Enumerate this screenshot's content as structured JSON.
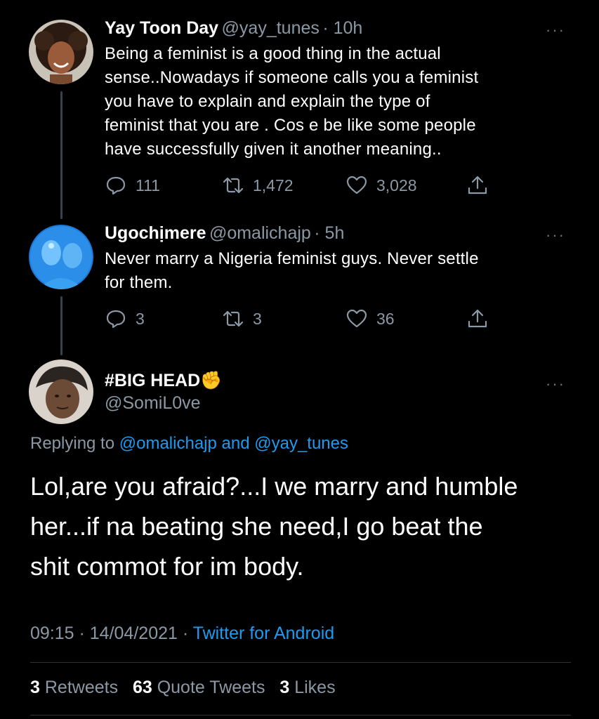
{
  "tweet1": {
    "display_name": "Yay Toon Day",
    "handle": "@yay_tunes",
    "time": "· 10h",
    "more": "···",
    "text_lines": [
      "Being a feminist is a good thing in the actual",
      "sense..Nowadays if someone calls you a feminist",
      "you have to explain and explain the type of",
      "feminist that you are . Cos e be like some people",
      "have successfully given it another meaning.."
    ],
    "replies": "111",
    "retweets": "1,472",
    "likes": "3,028"
  },
  "tweet2": {
    "display_name": "Ugochịmere",
    "handle": "@omalichajp",
    "time": "· 5h",
    "more": "···",
    "text_lines": [
      "Never marry a Nigeria feminist guys. Never settle",
      "for them."
    ],
    "replies": "3",
    "retweets": "3",
    "likes": "36"
  },
  "tweet3": {
    "display_name": "#BIG HEAD✊",
    "handle": "@SomiL0ve",
    "more": "···",
    "replying_prefix": "Replying to",
    "replying_user1": "@omalichajp",
    "replying_and": "and",
    "replying_user2": "@yay_tunes",
    "text_lines": [
      "Lol,are you afraid?...I we marry and humble",
      "her...if na beating she need,I go beat the",
      "shit commot for im body."
    ],
    "timestamp": "09:15 · 14/04/2021 ·",
    "source": "Twitter for Android",
    "stats": {
      "retweets_count": "3",
      "retweets_label": "Retweets",
      "quotes_count": "63",
      "quotes_label": "Quote Tweets",
      "likes_count": "3",
      "likes_label": "Likes"
    }
  }
}
